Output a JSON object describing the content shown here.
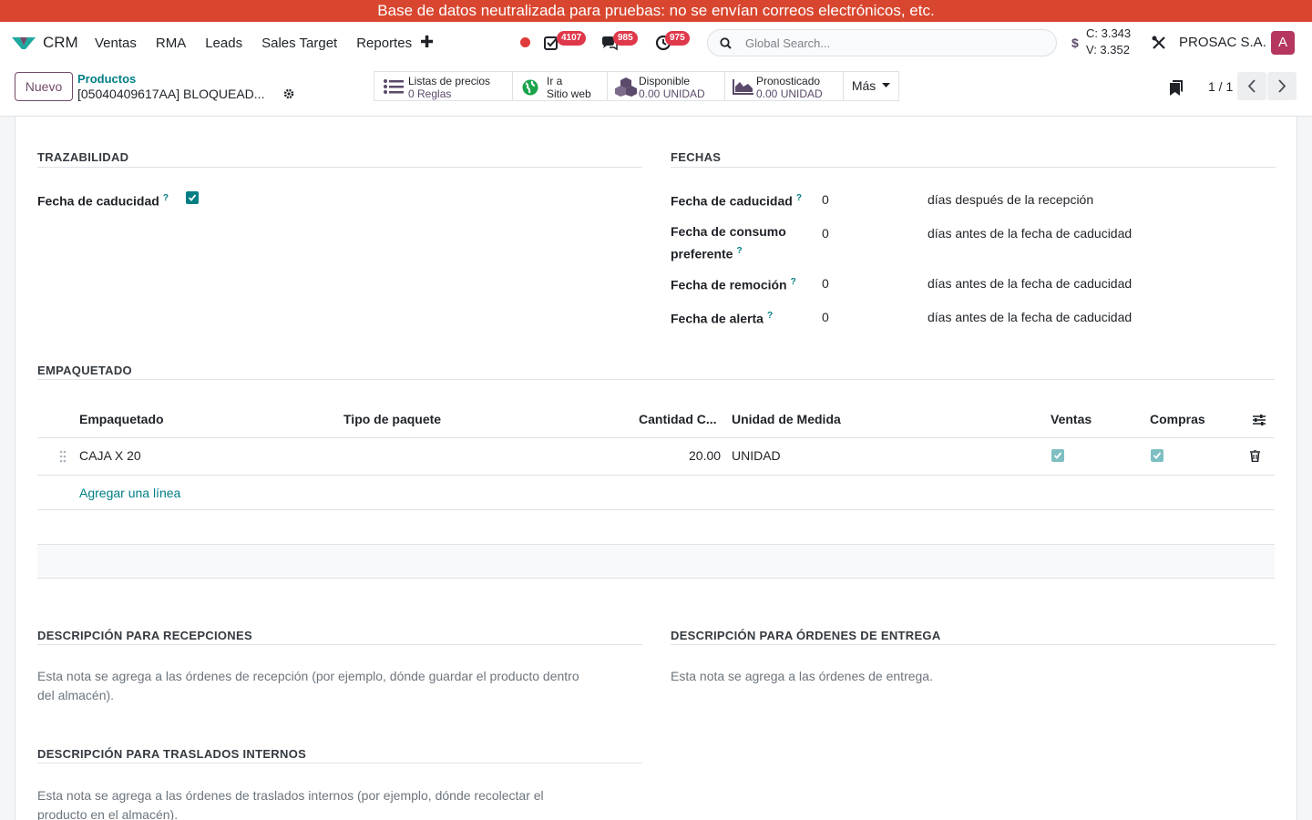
{
  "banner": "Base de datos neutralizada para pruebas: no se envían correos electrónicos, etc.",
  "navbar": {
    "app": "CRM",
    "menu": [
      "Ventas",
      "RMA",
      "Leads",
      "Sales Target",
      "Reportes"
    ],
    "plus": "✚",
    "badges": {
      "activities": "4107",
      "messages": "985",
      "timers": "975"
    },
    "search_placeholder": "Global Search...",
    "currency_symbol": "$",
    "rate_c": "C: 3.343",
    "rate_v": "V: 3.352",
    "company": "PROSAC S.A.",
    "avatar": "A"
  },
  "control": {
    "new_button": "Nuevo",
    "breadcrumb_parent": "Productos",
    "breadcrumb_current": "[05040409617AA] BLOQUEAD...",
    "smart_buttons": [
      {
        "line1": "Listas de precios",
        "line2": "0  Reglas"
      },
      {
        "line1": "Ir a",
        "line2": "Sitio web"
      },
      {
        "line1": "Disponible",
        "line2": "0.00 UNIDAD"
      },
      {
        "line1": "Pronosticado",
        "line2": "0.00 UNIDAD"
      }
    ],
    "more": "Más",
    "pager": "1 / 1"
  },
  "trazabilidad": {
    "title": "TRAZABILIDAD",
    "field": "Fecha de caducidad",
    "help": "?"
  },
  "fechas": {
    "title": "FECHAS",
    "rows": [
      {
        "label": "Fecha de caducidad",
        "value": "0",
        "suffix": "días después de la recepción"
      },
      {
        "label": "Fecha de consumo",
        "label2": "preferente",
        "value": "0",
        "suffix": "días antes de la fecha de caducidad"
      },
      {
        "label": "Fecha de remoción",
        "value": "0",
        "suffix": "días antes de la fecha de caducidad"
      },
      {
        "label": "Fecha de alerta",
        "value": "0",
        "suffix": "días antes de la fecha de caducidad"
      }
    ]
  },
  "empaquetado": {
    "title": "EMPAQUETADO",
    "headers": [
      "Empaquetado",
      "Tipo de paquete",
      "Cantidad C...",
      "Unidad de Medida",
      "Ventas",
      "Compras"
    ],
    "rows": [
      {
        "name": "CAJA X 20",
        "tipo": "",
        "cantidad": "20.00",
        "unidad": "UNIDAD",
        "ventas": true,
        "compras": true
      }
    ],
    "add_line": "Agregar una línea"
  },
  "recepciones": {
    "title": "DESCRIPCIÓN PARA RECEPCIONES",
    "line1": "Esta nota se agrega a las órdenes de recepción (por ejemplo, dónde guardar el producto dentro",
    "line2": "del almacén)."
  },
  "entrega": {
    "title": "DESCRIPCIÓN PARA ÓRDENES DE ENTREGA",
    "text": "Esta nota se agrega a las órdenes de entrega."
  },
  "internos": {
    "title": "DESCRIPCIÓN PARA TRASLADOS INTERNOS",
    "line1": "Esta nota se agrega a las órdenes de traslados internos (por ejemplo, dónde recolectar el",
    "line2": "producto en el almacén)."
  },
  "colors": {
    "brand": "#714b67",
    "teal": "#017e84",
    "banner": "#d9462f",
    "badge": "#e0384b"
  }
}
